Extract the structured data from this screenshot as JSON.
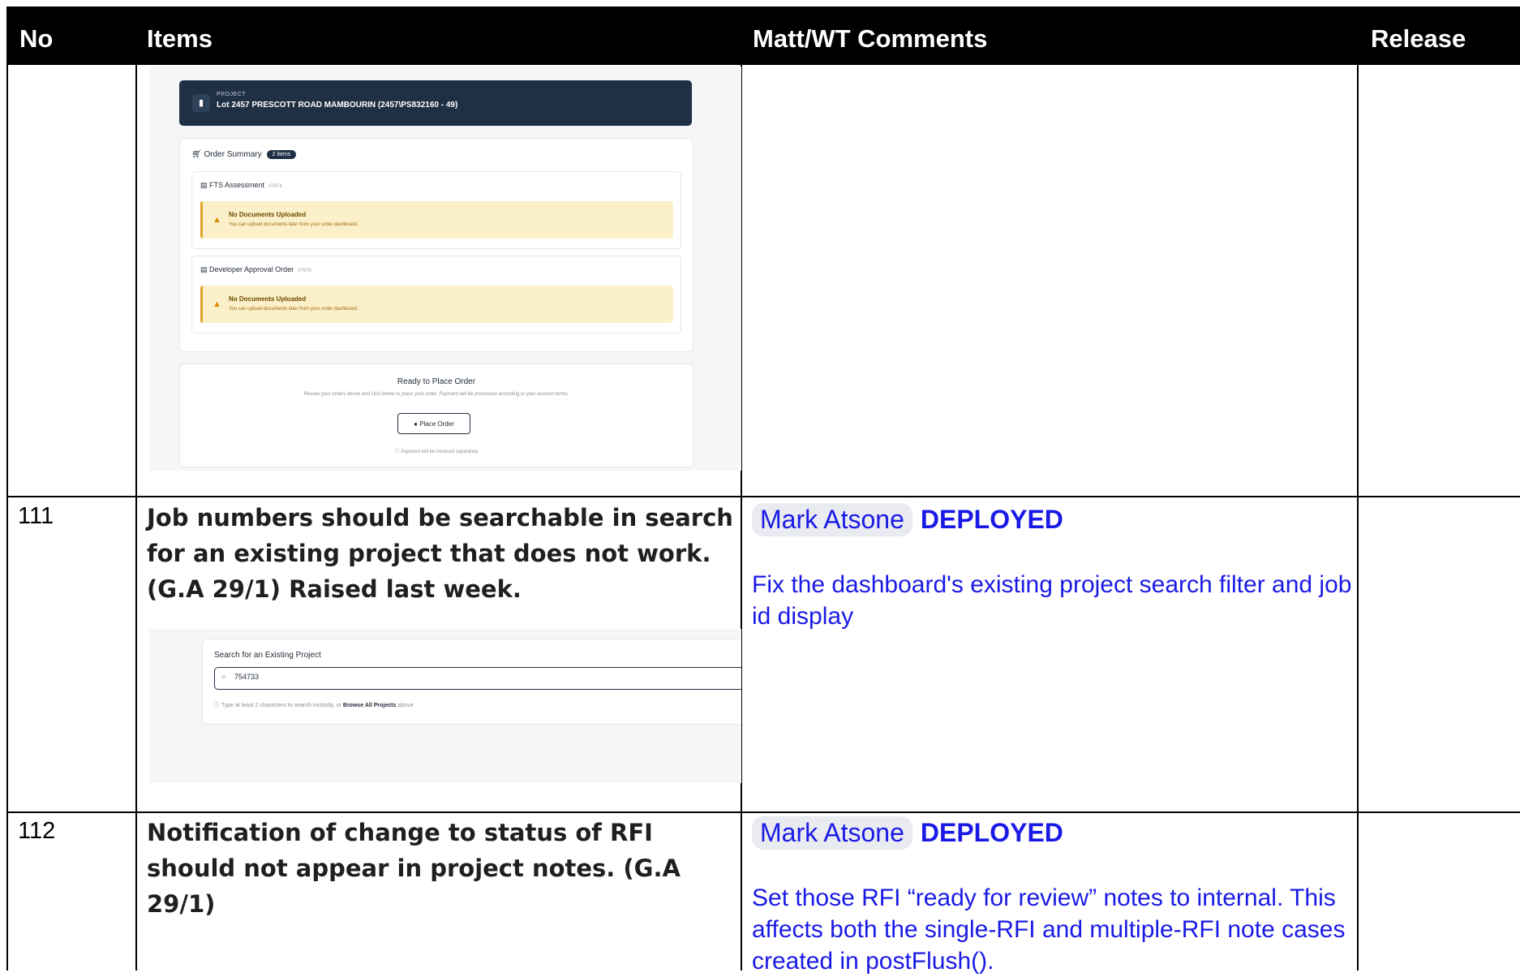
{
  "header": {
    "no": "No",
    "items": "Items",
    "comments": "Matt/WT Comments",
    "release": "Release"
  },
  "row0": {
    "shot": {
      "project_label": "PROJECT",
      "project_name": "Lot 2457 PRESCOTT ROAD MAMBOURIN (2457\\PS832160 - 49)",
      "summary_title": "Order Summary",
      "summary_badge": "2 items",
      "orders": [
        {
          "title": "FTS Assessment",
          "id": "#7674",
          "warn_title": "No Documents Uploaded",
          "warn_text": "You can upload documents later from your order dashboard."
        },
        {
          "title": "Developer Approval Order",
          "id": "#7676",
          "warn_title": "No Documents Uploaded",
          "warn_text": "You can upload documents later from your order dashboard."
        }
      ],
      "ready_title": "Ready to Place Order",
      "ready_text": "Review your orders above and click below to place your order. Payment will be processed according to your account terms.",
      "place_order": "Place Order",
      "invoice_note": "Payment will be invoiced separately"
    }
  },
  "row111": {
    "no": "111",
    "item": "Job numbers should be searchable in search for an existing project that does not work. (G.A 29/1) Raised last week.",
    "chip": "Mark Atsone",
    "status": "DEPLOYED",
    "comment": "Fix the dashboard's existing project search filter and job id display",
    "shot": {
      "search_title": "Search for an Existing Project",
      "search_value": "754733",
      "hint_prefix": "Type at least 2 characters to search instantly, or",
      "hint_link": "Browse All Projects",
      "hint_suffix": "above"
    }
  },
  "row112": {
    "no": "112",
    "item": "Notification of change to status of RFI should not appear in project notes. (G.A 29/1)",
    "chip": "Mark Atsone",
    "status": "DEPLOYED",
    "comment": "Set those RFI “ready for review” notes to internal. This affects both the single-RFI and multiple-RFI note cases created in postFlush()."
  },
  "colors": {
    "header_bg": "#000000",
    "comment_text": "#1a1ae6",
    "chip_bg": "#e9ebf1",
    "project_bar": "#1f3044",
    "warning_bg": "#fbf0c9"
  },
  "icons": [
    "building-icon",
    "cart-icon",
    "document-icon",
    "warning-icon",
    "check-circle-icon",
    "info-icon",
    "search-icon"
  ]
}
